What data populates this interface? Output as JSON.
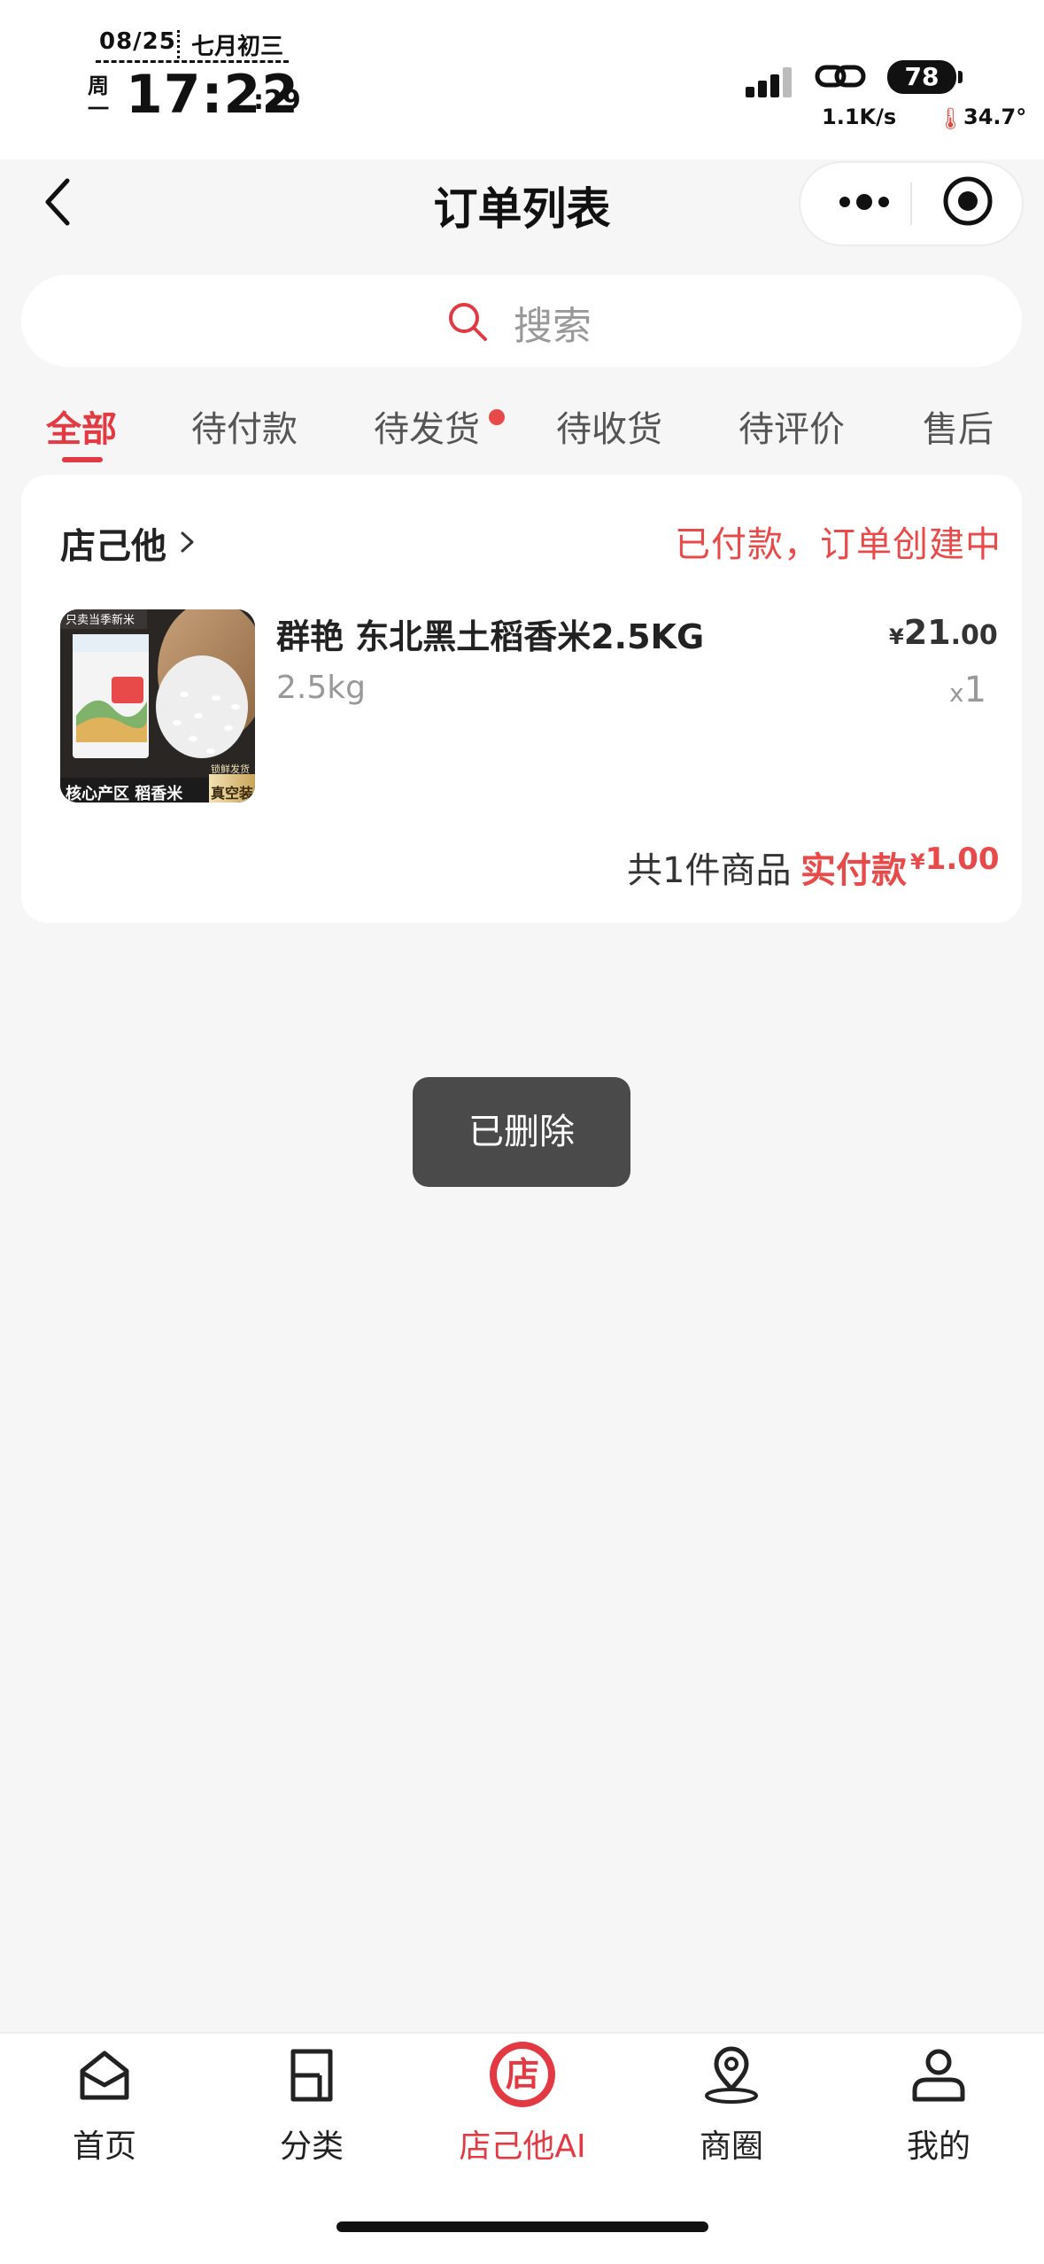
{
  "status_bar": {
    "date": "08/25",
    "lunar": "七月初三",
    "weekday": "周一",
    "time": "17:22",
    "seconds": ":29",
    "net_speed": "1.1K/s",
    "battery": "78",
    "temperature": "34.7°"
  },
  "nav": {
    "title": "订单列表",
    "back_icon": "chevron-left-icon",
    "more_icon": "more-dots-icon",
    "close_icon": "target-icon"
  },
  "search": {
    "placeholder": "搜索"
  },
  "tabs": [
    {
      "label": "全部",
      "active": true
    },
    {
      "label": "待付款"
    },
    {
      "label": "待发货",
      "badge_dot": true
    },
    {
      "label": "待收货"
    },
    {
      "label": "待评价"
    },
    {
      "label": "售后"
    }
  ],
  "order": {
    "shop_name": "店己他",
    "status": "已付款，订单创建中",
    "product": {
      "name": "群艳 东北黑土稻香米2.5KG",
      "spec": "2.5kg",
      "price_symbol": "¥",
      "price_int": "21",
      "price_dec": ".00",
      "qty_x": "x",
      "qty_n": "1",
      "thumb_texts": {
        "top_banner": "只卖当季新米",
        "bottom_left": "核心产区 稻香米",
        "badge_small": "锁鲜发货",
        "badge_big": "真空装"
      }
    },
    "summary": {
      "count_text": "共1件商品",
      "paid_label": "实付款",
      "paid_symbol": "¥",
      "paid_value": "1.00"
    }
  },
  "toast": {
    "text": "已删除"
  },
  "tabbar": [
    {
      "label": "首页",
      "icon": "home-icon"
    },
    {
      "label": "分类",
      "icon": "category-icon"
    },
    {
      "label": "店己他AI",
      "icon": "store-logo-icon",
      "active": true
    },
    {
      "label": "商圈",
      "icon": "location-pin-icon"
    },
    {
      "label": "我的",
      "icon": "profile-icon"
    }
  ],
  "colors": {
    "accent": "#e23943",
    "status_red": "#e84a4a",
    "background": "#f6f6f6",
    "toast_bg": "#4a4a4a"
  }
}
